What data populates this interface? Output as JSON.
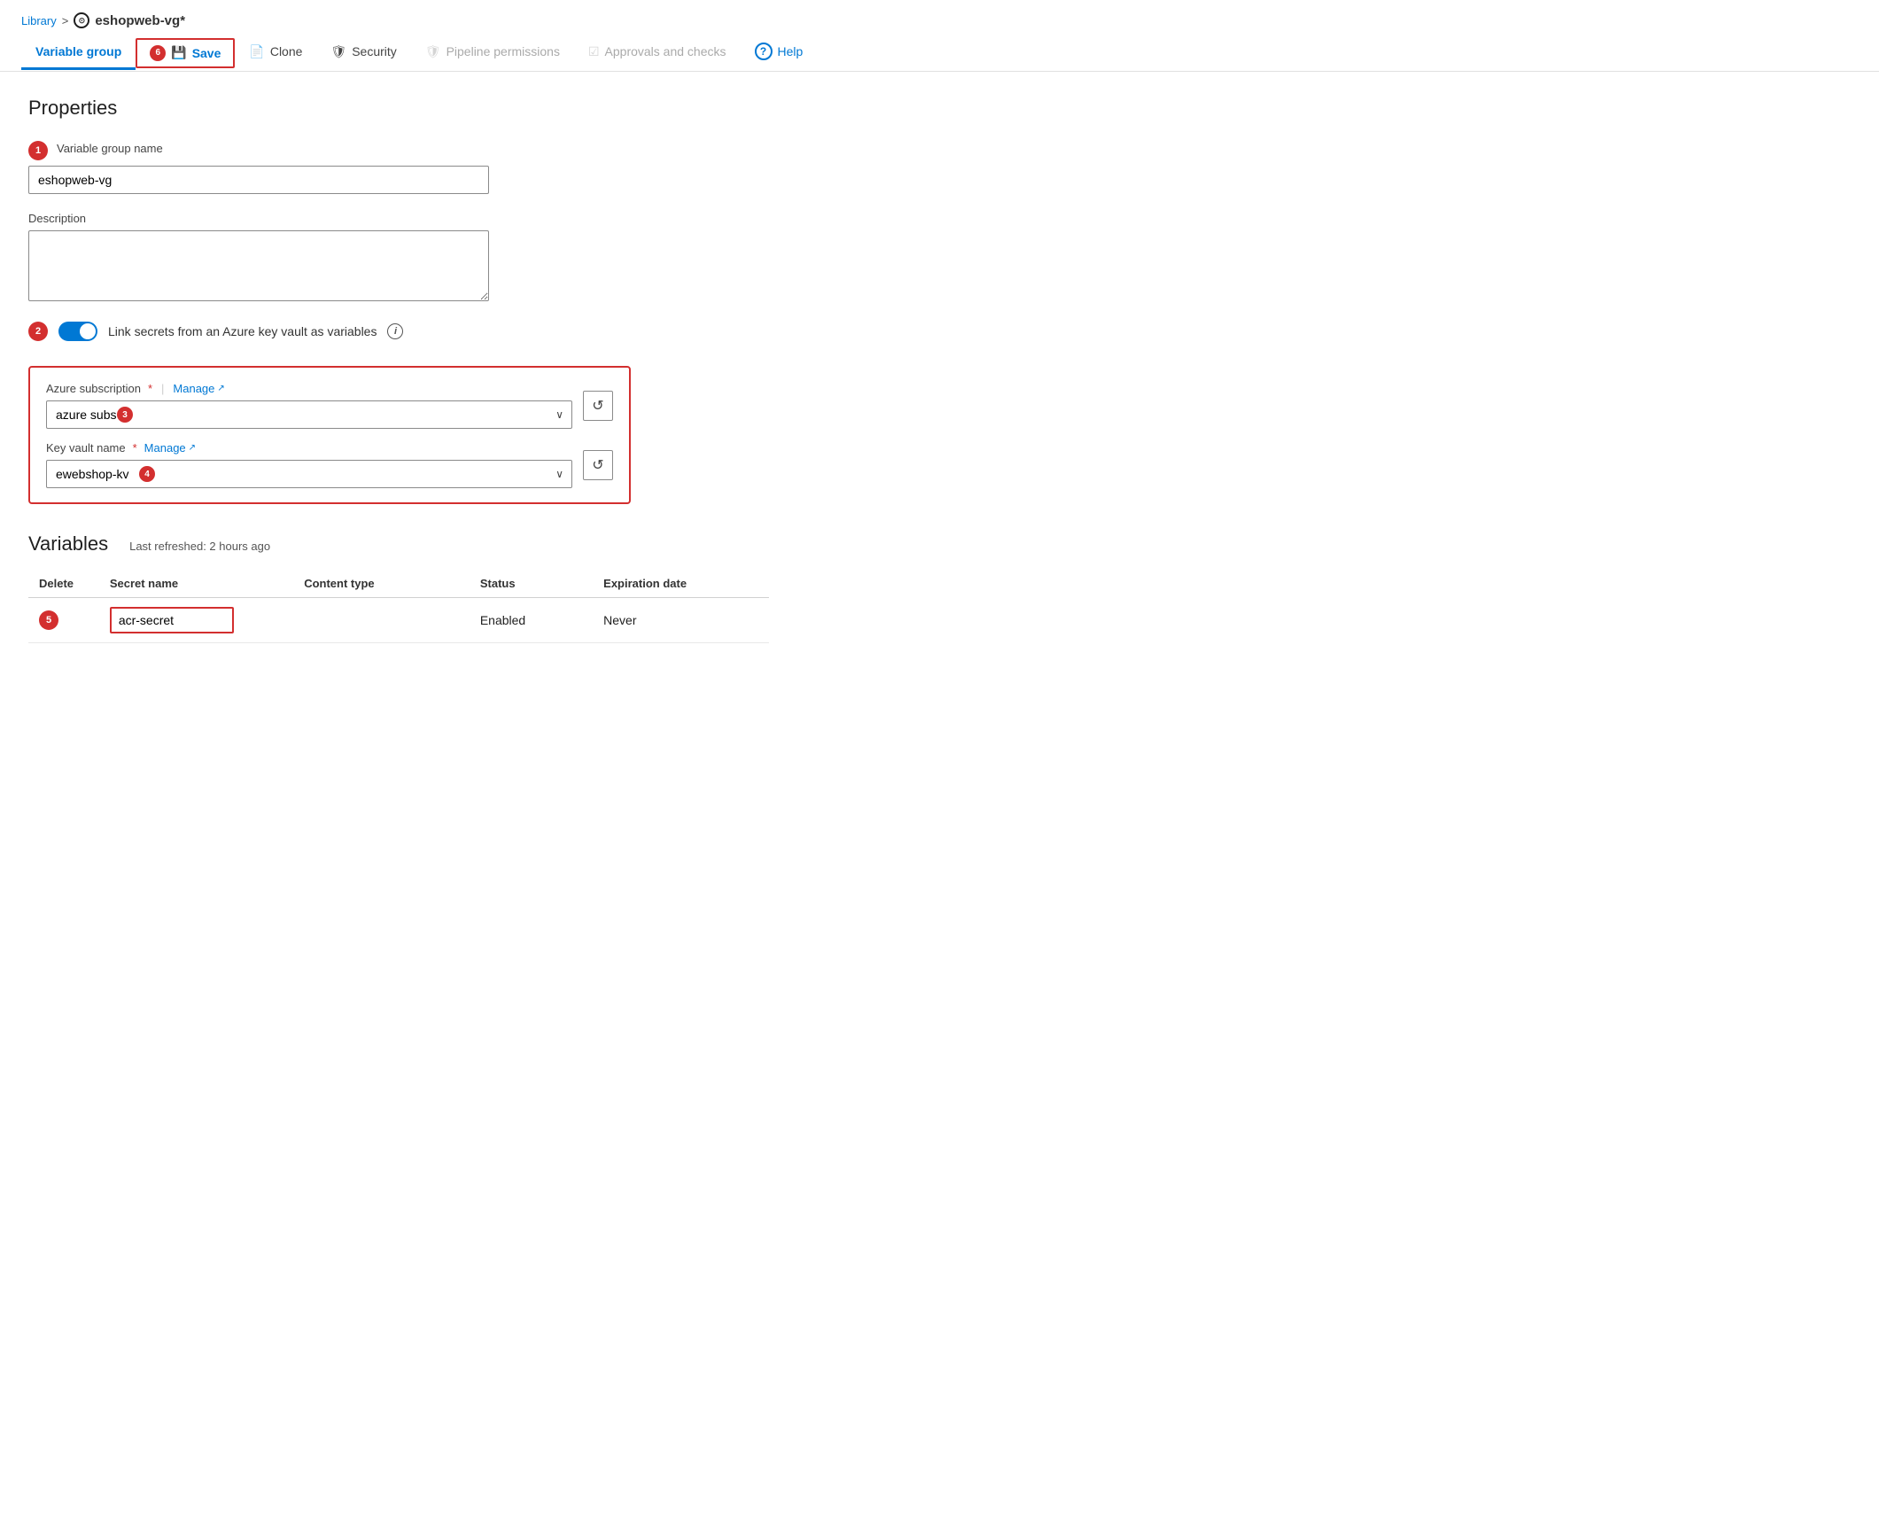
{
  "breadcrumb": {
    "library_label": "Library",
    "separator": ">",
    "icon_symbol": "⊙",
    "page_name": "eshopweb-vg*"
  },
  "toolbar": {
    "variable_group_label": "Variable group",
    "save_label": "Save",
    "clone_label": "Clone",
    "security_label": "Security",
    "pipeline_permissions_label": "Pipeline permissions",
    "approvals_label": "Approvals and checks",
    "help_label": "Help",
    "save_badge": "6"
  },
  "properties": {
    "section_title": "Properties",
    "name_label": "Variable group name",
    "name_value": "eshopweb-vg",
    "description_label": "Description",
    "description_value": "",
    "step1_badge": "1",
    "step2_badge": "2",
    "toggle_label": "Link secrets from an Azure key vault as variables"
  },
  "vault": {
    "subscription_label": "Azure subscription",
    "subscription_required": "*",
    "manage_label": "Manage",
    "subscription_value": "azure subs",
    "subscription_badge": "3",
    "key_vault_label": "Key vault name",
    "key_vault_required": "*",
    "key_vault_manage_label": "Manage",
    "key_vault_value": "ewebshop-kv",
    "key_vault_badge": "4"
  },
  "variables": {
    "section_title": "Variables",
    "last_refreshed": "Last refreshed: 2 hours ago",
    "columns": {
      "delete": "Delete",
      "secret_name": "Secret name",
      "content_type": "Content type",
      "status": "Status",
      "expiration_date": "Expiration date"
    },
    "rows": [
      {
        "step_badge": "5",
        "secret_name": "acr-secret",
        "content_type": "",
        "status": "Enabled",
        "expiration_date": "Never"
      }
    ]
  },
  "icons": {
    "save_icon": "💾",
    "clone_icon": "📄",
    "shield_icon": "🛡",
    "refresh_icon": "↺",
    "chevron_down": "∨",
    "external_link": "↗",
    "question_mark": "?"
  }
}
